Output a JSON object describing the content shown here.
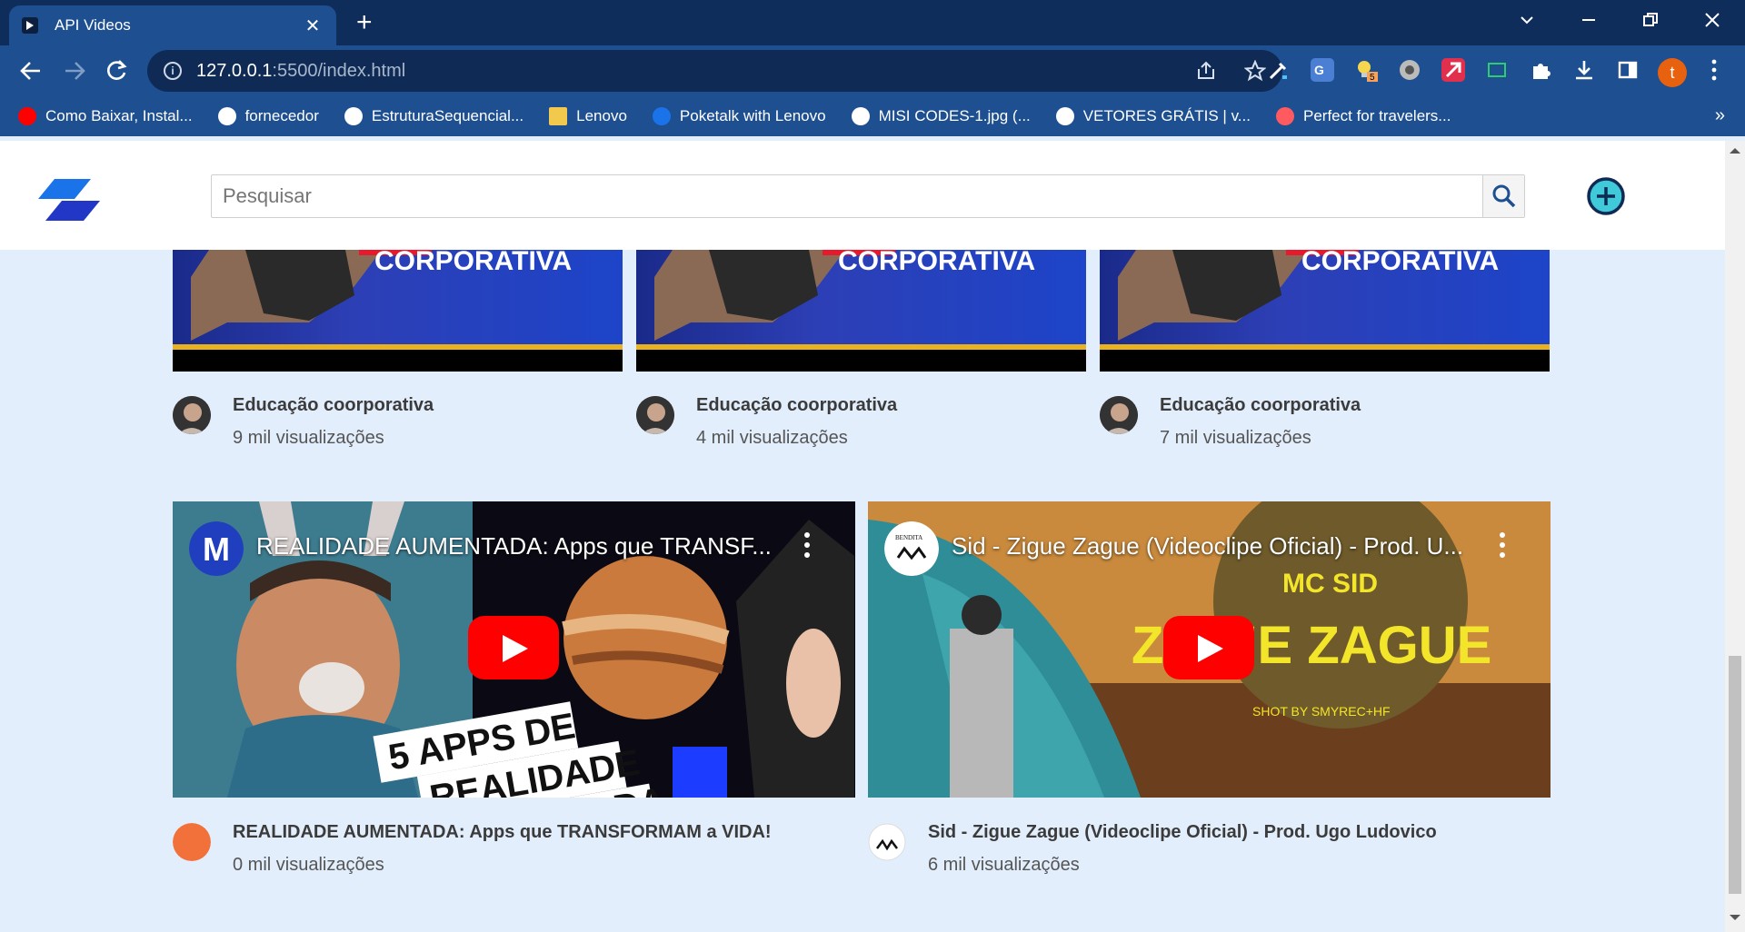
{
  "browser": {
    "tab_title": "API Videos",
    "tab_close": "✕",
    "new_tab": "+",
    "url_host": "127.0.0.1",
    "url_path": ":5500/index.html",
    "profile_initial": "t",
    "extension_badge": "5",
    "bookmarks": [
      {
        "label": "Como Baixar, Instal...",
        "icon": "youtube-icon",
        "color": "#ff0000"
      },
      {
        "label": "fornecedor",
        "icon": "globe-icon",
        "color": "#ffffff"
      },
      {
        "label": "EstruturaSequencial...",
        "icon": "globe-icon",
        "color": "#ffffff"
      },
      {
        "label": "Lenovo",
        "icon": "folder-icon",
        "color": "#f2c94c"
      },
      {
        "label": "Poketalk with Lenovo",
        "icon": "s-icon",
        "color": "#1a73e8"
      },
      {
        "label": "MISI CODES-1.jpg (...",
        "icon": "globe-icon",
        "color": "#ffffff"
      },
      {
        "label": "VETORES GRÁTIS | v...",
        "icon": "wordpress-icon",
        "color": "#ffffff"
      },
      {
        "label": "Perfect for travelers...",
        "icon": "airbnb-icon",
        "color": "#ff5a5f"
      }
    ],
    "bookmarks_more": "»"
  },
  "header": {
    "search_placeholder": "Pesquisar"
  },
  "videos_top": [
    {
      "title": "Educação coorporativa",
      "views": "9 mil visualizações"
    },
    {
      "title": "Educação coorporativa",
      "views": "4 mil visualizações"
    },
    {
      "title": "Educação coorporativa",
      "views": "7 mil visualizações"
    }
  ],
  "thumbnail_text": "CORPORATIVA",
  "videos_bottom": [
    {
      "embed_title": "REALIDADE AUMENTADA: Apps que TRANSF...",
      "channel_initial": "M",
      "overlay_text": [
        "5 APPS DE",
        "REALIDADE",
        "AUMENTADA"
      ],
      "title": "REALIDADE AUMENTADA: Apps que TRANSFORMAM a VIDA!",
      "views": "0 mil visualizações"
    },
    {
      "embed_title": "Sid - Zigue Zague (Videoclipe Oficial) - Prod. U...",
      "channel_initial": "BENDITA",
      "overlay_text": [
        "MC SID",
        "ZIGUE ZAGUE",
        "SHOT BY SMYREC+HF"
      ],
      "title": "Sid - Zigue Zague (Videoclipe Oficial) - Prod. Ugo Ludovico",
      "views": "6 mil visualizações"
    }
  ]
}
